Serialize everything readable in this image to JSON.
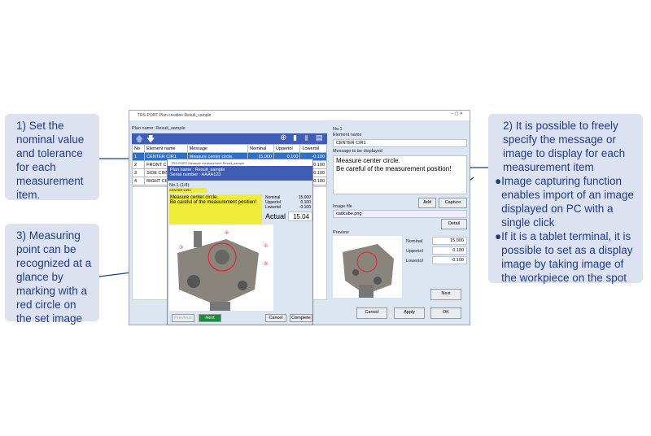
{
  "callouts": {
    "c1": "1) Set the nominal value and tolerance for each measurement item.",
    "c3": "3) Measuring point can be recognized at a glance by marking with a red circle on the set image",
    "c2": "2) It is possible to freely specify the message or image to display for each measurement item",
    "b1": "Image capturing function enables import of an image displayed on PC with a single click",
    "b2": "If it is a tablet terminal, it is possible to set as a display image by taking image of the workpiece on the spot"
  },
  "window": {
    "title": "TRS-PORT Plan creation Result_sample",
    "plan_name": "Plan name: Result_sample"
  },
  "table": {
    "headers": [
      "No",
      "Element name",
      "Message",
      "Nominal",
      "Uppertol",
      "Lowertol"
    ],
    "rows": [
      [
        "1",
        "CENTER CIR1",
        "Measure center circle.",
        "15.000",
        "0.100",
        "-0.100"
      ],
      [
        "2",
        "FRONT CIR2",
        "",
        "",
        "",
        "0.100"
      ],
      [
        "3",
        "SIDE CIR5",
        "",
        "",
        "",
        "0.100"
      ],
      [
        "4",
        "RIGHT CIR2",
        "",
        "",
        "",
        "0.100"
      ]
    ]
  },
  "dialog": {
    "title": "TRS-PORT Measure measurement Result_sample",
    "plan_name": "Plan name : Result_sample",
    "serial": "Serial number : AAAA123",
    "no": "No.1 (1/4)",
    "element": "CENTER CIR1",
    "message_line1": "Measure center circle.",
    "message_line2": "Be careful of the measurement position!",
    "nominal_label": "Nominal",
    "nominal": "15.000",
    "upper_label": "Uppertol",
    "upper": "0.100",
    "lower_label": "Lowertol",
    "lower": "-0.100",
    "actual_label": "Actual",
    "actual": "15.04",
    "previous": "Previous",
    "next": "Next",
    "cancel": "Cancel",
    "complete": "Complete"
  },
  "editor": {
    "no": "No.1",
    "element_label": "Element name",
    "element": "CENTER CIR1",
    "message_label": "Message to be displayed",
    "message_line1": "Measure center circle.",
    "message_line2": "Be careful of the measurement position!",
    "add": "Add",
    "capture": "Capture",
    "image_label": "Image file",
    "image_file": "cadcube.png",
    "detail": "Detail",
    "preview": "Preview",
    "nominal_label": "Nominal",
    "nominal": "15.000",
    "upper_label": "Uppertol",
    "upper": "0.100",
    "lower_label": "Lowertol",
    "lower": "-0.100",
    "next": "Next",
    "cancel": "Cancel",
    "apply": "Apply",
    "ok": "OK"
  },
  "colors": {
    "callout_bg": "#dde2f1",
    "callout_text": "#1b3c8f",
    "toolbar": "#3f5db5",
    "highlight": "#f0ec3a",
    "next_button": "#1e8a3c"
  }
}
